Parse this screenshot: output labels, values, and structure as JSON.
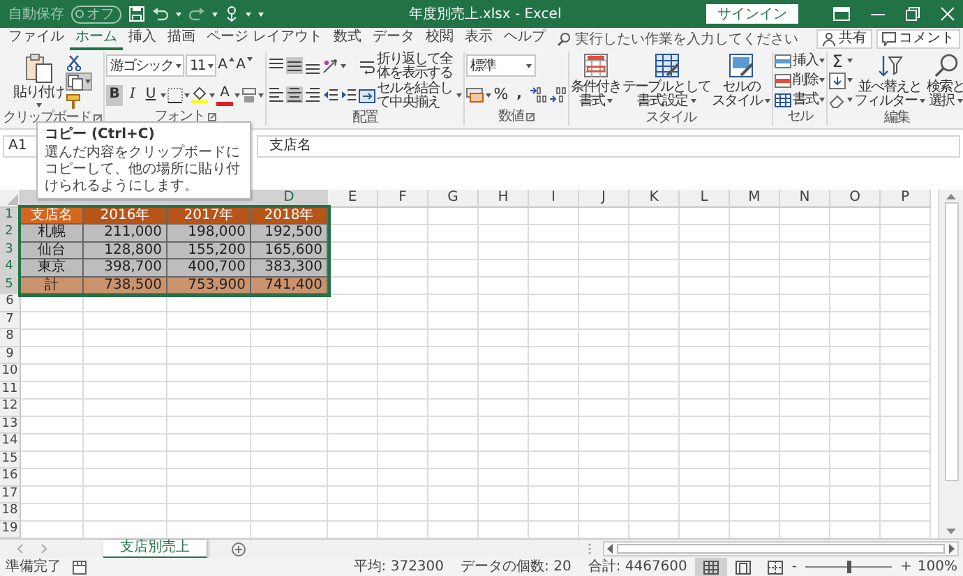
{
  "title_bar": {
    "autosave": "自動保存",
    "autosave_state": "オフ",
    "autosave_on": false,
    "title": "年度別売上.xlsx - Excel",
    "sign_in": "サインイン"
  },
  "tabs": [
    {
      "label": "ファイル",
      "selected": false
    },
    {
      "label": "ホーム",
      "selected": true
    },
    {
      "label": "挿入",
      "selected": false
    },
    {
      "label": "描画",
      "selected": false
    },
    {
      "label": "ページ レイアウト",
      "selected": false
    },
    {
      "label": "数式",
      "selected": false
    },
    {
      "label": "データ",
      "selected": false
    },
    {
      "label": "校閲",
      "selected": false
    },
    {
      "label": "表示",
      "selected": false
    },
    {
      "label": "ヘルプ",
      "selected": false
    }
  ],
  "search": {
    "placeholder": "実行したい作業を入力してください"
  },
  "share": "共有",
  "comment": "コメント",
  "ribbon": {
    "clipboard": {
      "label": "クリップボード",
      "paste": "貼り付け",
      "copy_highlighted": true
    },
    "font": {
      "label": "フォント",
      "name": "游ゴシック",
      "size": "11",
      "grow": "A",
      "shrink": "A",
      "bold": "B",
      "italic": "I",
      "underline": "U",
      "color_letter": "A",
      "bold_on": true,
      "italic_on": false,
      "underline_on": false
    },
    "alignment": {
      "label": "配置",
      "vertical_align": [
        {
          "selected": false
        },
        {
          "selected": true
        },
        {
          "selected": false
        }
      ],
      "horizontal_align": [
        {
          "selected": false
        },
        {
          "selected": true
        },
        {
          "selected": false
        }
      ],
      "wrap": "折り返して全体を表示する",
      "merge": "セルを結合して中央揃え"
    },
    "number": {
      "label": "数値",
      "format": "標準",
      "percent": "%",
      "comma": ","
    },
    "styles": {
      "label": "スタイル",
      "buttons": [
        {
          "lines": [
            "条件付き",
            "書式"
          ]
        },
        {
          "lines": [
            "テーブルとして",
            "書式設定"
          ]
        },
        {
          "lines": [
            "セルの",
            "スタイル"
          ]
        }
      ]
    },
    "cells": {
      "label": "セル",
      "buttons": [
        "挿入",
        "削除",
        "書式"
      ]
    },
    "editing": {
      "label": "編集",
      "sum": "Σ",
      "buttons": [
        {
          "lines": [
            "並べ替えと",
            "フィルター"
          ]
        },
        {
          "lines": [
            "検索と",
            "選択"
          ]
        }
      ]
    }
  },
  "formula_bar": {
    "name_box": "A1",
    "value": "支店名"
  },
  "tooltip": {
    "title": "コピー (Ctrl+C)",
    "text": "選んだ内容をクリップボードにコピーして、他の場所に貼り付けられるようにします。"
  },
  "columns": [
    {
      "label": "D",
      "selected": true
    },
    {
      "label": "E",
      "selected": false
    },
    {
      "label": "F",
      "selected": false
    },
    {
      "label": "G",
      "selected": false
    },
    {
      "label": "H",
      "selected": false
    },
    {
      "label": "I",
      "selected": false
    },
    {
      "label": "J",
      "selected": false
    },
    {
      "label": "K",
      "selected": false
    },
    {
      "label": "L",
      "selected": false
    },
    {
      "label": "M",
      "selected": false
    },
    {
      "label": "N",
      "selected": false
    },
    {
      "label": "O",
      "selected": false
    },
    {
      "label": "P",
      "selected": false
    }
  ],
  "rows": [
    {
      "label": "1",
      "selected": true,
      "cells": [
        {
          "text": "支店名",
          "kind": "header",
          "selected": true,
          "active": true
        },
        {
          "text": "2016年",
          "kind": "header",
          "selected": true,
          "active": false
        },
        {
          "text": "2017年",
          "kind": "header",
          "selected": true,
          "active": false
        },
        {
          "text": "2018年",
          "kind": "header",
          "selected": true,
          "active": false
        }
      ]
    },
    {
      "label": "2",
      "selected": true,
      "cells": [
        {
          "text": "札幌",
          "kind": "body",
          "selected": true,
          "active": false
        },
        {
          "text": "211,000",
          "kind": "body",
          "selected": true,
          "active": false
        },
        {
          "text": "198,000",
          "kind": "body",
          "selected": true,
          "active": false
        },
        {
          "text": "192,500",
          "kind": "body",
          "selected": true,
          "active": false
        }
      ]
    },
    {
      "label": "3",
      "selected": true,
      "cells": [
        {
          "text": "仙台",
          "kind": "body",
          "selected": true,
          "active": false
        },
        {
          "text": "128,800",
          "kind": "body",
          "selected": true,
          "active": false
        },
        {
          "text": "155,200",
          "kind": "body",
          "selected": true,
          "active": false
        },
        {
          "text": "165,600",
          "kind": "body",
          "selected": true,
          "active": false
        }
      ]
    },
    {
      "label": "4",
      "selected": true,
      "cells": [
        {
          "text": "東京",
          "kind": "body",
          "selected": true,
          "active": false
        },
        {
          "text": "398,700",
          "kind": "body",
          "selected": true,
          "active": false
        },
        {
          "text": "400,700",
          "kind": "body",
          "selected": true,
          "active": false
        },
        {
          "text": "383,300",
          "kind": "body",
          "selected": true,
          "active": false
        }
      ]
    },
    {
      "label": "5",
      "selected": true,
      "cells": [
        {
          "text": "計",
          "kind": "total",
          "selected": true,
          "active": false
        },
        {
          "text": "738,500",
          "kind": "total",
          "selected": true,
          "active": false
        },
        {
          "text": "753,900",
          "kind": "total",
          "selected": true,
          "active": false
        },
        {
          "text": "741,400",
          "kind": "total",
          "selected": true,
          "active": false
        }
      ]
    },
    {
      "label": "6",
      "selected": false
    },
    {
      "label": "7",
      "selected": false
    },
    {
      "label": "8",
      "selected": false
    },
    {
      "label": "9",
      "selected": false
    },
    {
      "label": "10",
      "selected": false
    },
    {
      "label": "11",
      "selected": false
    },
    {
      "label": "12",
      "selected": false
    },
    {
      "label": "13",
      "selected": false
    },
    {
      "label": "14",
      "selected": false
    },
    {
      "label": "15",
      "selected": false
    },
    {
      "label": "16",
      "selected": false
    },
    {
      "label": "17",
      "selected": false
    },
    {
      "label": "18",
      "selected": false
    },
    {
      "label": "19",
      "selected": false
    }
  ],
  "sheet_tabs": [
    {
      "label": "支店別売上",
      "selected": true
    }
  ],
  "status_bar": {
    "mode": "準備完了",
    "average": "平均: 372300",
    "count": "データの個数: 20",
    "sum": "合計: 4467600",
    "views": [
      {
        "selected": true
      },
      {
        "selected": false
      },
      {
        "selected": false
      }
    ],
    "zoom_minus": "-",
    "zoom_slider": {
      "level": 0.5
    },
    "zoom_plus": "+",
    "zoom": "100%"
  }
}
